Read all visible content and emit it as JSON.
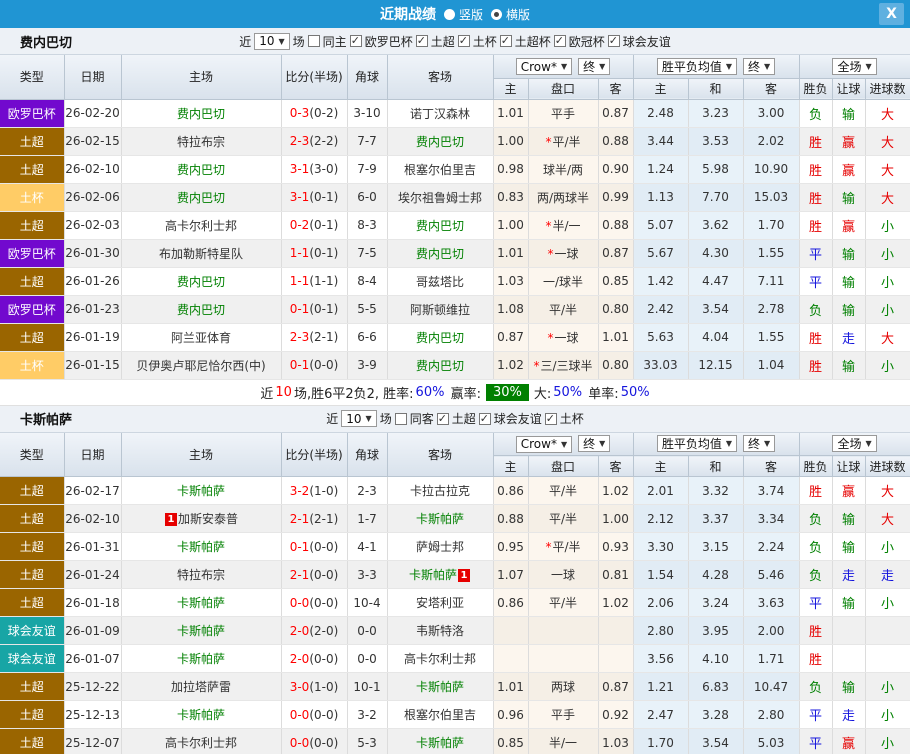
{
  "titlebar": {
    "title": "近期战绩",
    "radio_vertical": "竖版",
    "radio_horizontal": "横版",
    "selected_mode": "横版",
    "close_label": "X"
  },
  "colors": {
    "topbar": "#2095d3",
    "type_badges": {
      "欧罗巴杯": "#7209ce",
      "土超": "#9a6500",
      "土杯": "#ffcc66",
      "球会友谊": "#18a5a5",
      "欧冠杯": "#7209ce",
      "土超杯": "#9a6500"
    },
    "win_red": "#e60000",
    "lose_green": "#008000",
    "draw_blue": "#1414dd",
    "summary_badge_green": "#008000"
  },
  "table_header": {
    "type": "类型",
    "date": "日期",
    "home": "主场",
    "score": "比分(半场)",
    "corner": "角球",
    "away": "客场",
    "odds_group": "Crow*",
    "final1": "终",
    "mean_group": "胜平负均值",
    "final2": "终",
    "full_group": "全场",
    "sub": [
      "主",
      "盘口",
      "客",
      "主",
      "和",
      "客",
      "胜负",
      "让球",
      "进球数"
    ]
  },
  "sections": [
    {
      "team": "费内巴切",
      "filter": {
        "near": "近",
        "count": "10",
        "games": "场",
        "same": "同主",
        "same_checked": false,
        "leagues": [
          "欧罗巴杯",
          "土超",
          "土杯",
          "土超杯",
          "欧冠杯",
          "球会友谊"
        ]
      },
      "rows": [
        {
          "t": "欧罗巴杯",
          "d": "26-02-20",
          "h": "费内巴切",
          "hg": true,
          "hb": "",
          "s": "0-3",
          "hf": "(0-2)",
          "c": "3-10",
          "a": "诺丁汉森林",
          "ag": false,
          "ab": "",
          "o1": "1.01",
          "st": false,
          "hc": "平手",
          "o2": "0.87",
          "m1": "2.48",
          "m2": "3.23",
          "m3": "3.00",
          "r1": "负",
          "c1": "g",
          "r2": "输",
          "c2": "g",
          "r3": "大",
          "c3": "r"
        },
        {
          "t": "土超",
          "d": "26-02-15",
          "h": "特拉布宗",
          "hg": false,
          "hb": "",
          "s": "2-3",
          "hf": "(2-2)",
          "c": "7-7",
          "a": "费内巴切",
          "ag": true,
          "ab": "",
          "o1": "1.00",
          "st": true,
          "hc": "平/半",
          "o2": "0.88",
          "m1": "3.44",
          "m2": "3.53",
          "m3": "2.02",
          "r1": "胜",
          "c1": "r",
          "r2": "赢",
          "c2": "r",
          "r3": "大",
          "c3": "r"
        },
        {
          "t": "土超",
          "d": "26-02-10",
          "h": "费内巴切",
          "hg": true,
          "hb": "",
          "s": "3-1",
          "hf": "(3-0)",
          "c": "7-9",
          "a": "根塞尔伯里吉",
          "ag": false,
          "ab": "",
          "o1": "0.98",
          "st": false,
          "hc": "球半/两",
          "o2": "0.90",
          "m1": "1.24",
          "m2": "5.98",
          "m3": "10.90",
          "r1": "胜",
          "c1": "r",
          "r2": "赢",
          "c2": "r",
          "r3": "大",
          "c3": "r"
        },
        {
          "t": "土杯",
          "d": "26-02-06",
          "h": "费内巴切",
          "hg": true,
          "hb": "",
          "s": "3-1",
          "hf": "(0-1)",
          "c": "6-0",
          "a": "埃尔祖鲁姆士邦",
          "ag": false,
          "ab": "",
          "o1": "0.83",
          "st": false,
          "hc": "两/两球半",
          "o2": "0.99",
          "m1": "1.13",
          "m2": "7.70",
          "m3": "15.03",
          "r1": "胜",
          "c1": "r",
          "r2": "输",
          "c2": "g",
          "r3": "大",
          "c3": "r"
        },
        {
          "t": "土超",
          "d": "26-02-03",
          "h": "高卡尔利士邦",
          "hg": false,
          "hb": "",
          "s": "0-2",
          "hf": "(0-1)",
          "c": "8-3",
          "a": "费内巴切",
          "ag": true,
          "ab": "",
          "o1": "1.00",
          "st": true,
          "hc": "半/一",
          "o2": "0.88",
          "m1": "5.07",
          "m2": "3.62",
          "m3": "1.70",
          "r1": "胜",
          "c1": "r",
          "r2": "赢",
          "c2": "r",
          "r3": "小",
          "c3": "g"
        },
        {
          "t": "欧罗巴杯",
          "d": "26-01-30",
          "h": "布加勒斯特星队",
          "hg": false,
          "hb": "",
          "s": "1-1",
          "hf": "(0-1)",
          "c": "7-5",
          "a": "费内巴切",
          "ag": true,
          "ab": "",
          "o1": "1.01",
          "st": true,
          "hc": "一球",
          "o2": "0.87",
          "m1": "5.67",
          "m2": "4.30",
          "m3": "1.55",
          "r1": "平",
          "c1": "b",
          "r2": "输",
          "c2": "g",
          "r3": "小",
          "c3": "g"
        },
        {
          "t": "土超",
          "d": "26-01-26",
          "h": "费内巴切",
          "hg": true,
          "hb": "",
          "s": "1-1",
          "hf": "(1-1)",
          "c": "8-4",
          "a": "哥兹塔比",
          "ag": false,
          "ab": "",
          "o1": "1.03",
          "st": false,
          "hc": "一/球半",
          "o2": "0.85",
          "m1": "1.42",
          "m2": "4.47",
          "m3": "7.11",
          "r1": "平",
          "c1": "b",
          "r2": "输",
          "c2": "g",
          "r3": "小",
          "c3": "g"
        },
        {
          "t": "欧罗巴杯",
          "d": "26-01-23",
          "h": "费内巴切",
          "hg": true,
          "hb": "",
          "s": "0-1",
          "hf": "(0-1)",
          "c": "5-5",
          "a": "阿斯顿维拉",
          "ag": false,
          "ab": "",
          "o1": "1.08",
          "st": false,
          "hc": "平/半",
          "o2": "0.80",
          "m1": "2.42",
          "m2": "3.54",
          "m3": "2.78",
          "r1": "负",
          "c1": "g",
          "r2": "输",
          "c2": "g",
          "r3": "小",
          "c3": "g"
        },
        {
          "t": "土超",
          "d": "26-01-19",
          "h": "阿兰亚体育",
          "hg": false,
          "hb": "",
          "s": "2-3",
          "hf": "(2-1)",
          "c": "6-6",
          "a": "费内巴切",
          "ag": true,
          "ab": "",
          "o1": "0.87",
          "st": true,
          "hc": "一球",
          "o2": "1.01",
          "m1": "5.63",
          "m2": "4.04",
          "m3": "1.55",
          "r1": "胜",
          "c1": "r",
          "r2": "走",
          "c2": "b",
          "r3": "大",
          "c3": "r"
        },
        {
          "t": "土杯",
          "d": "26-01-15",
          "h": "贝伊奥卢耶尼恰尔西(中)",
          "hg": false,
          "hb": "",
          "s": "0-1",
          "hf": "(0-0)",
          "c": "3-9",
          "a": "费内巴切",
          "ag": true,
          "ab": "",
          "o1": "1.02",
          "st": true,
          "hc": "三/三球半",
          "o2": "0.80",
          "m1": "33.03",
          "m2": "12.15",
          "m3": "1.04",
          "r1": "胜",
          "c1": "r",
          "r2": "输",
          "c2": "g",
          "r3": "小",
          "c3": "g"
        }
      ],
      "summary": {
        "p1": "近",
        "n": "10",
        "p2": "场,胜6平2负2, 胜率:",
        "win_rate": "60%",
        "p3": "赢率:",
        "badge": "30%",
        "p4": "大:",
        "big_rate": "50%",
        "p5": "单率:",
        "single_rate": "50%"
      }
    },
    {
      "team": "卡斯帕萨",
      "filter": {
        "near": "近",
        "count": "10",
        "games": "场",
        "same": "同客",
        "same_checked": false,
        "leagues": [
          "土超",
          "球会友谊",
          "土杯"
        ]
      },
      "rows": [
        {
          "t": "土超",
          "d": "26-02-17",
          "h": "卡斯帕萨",
          "hg": true,
          "hb": "",
          "s": "3-2",
          "hf": "(1-0)",
          "c": "2-3",
          "a": "卡拉古拉克",
          "ag": false,
          "ab": "",
          "o1": "0.86",
          "st": false,
          "hc": "平/半",
          "o2": "1.02",
          "m1": "2.01",
          "m2": "3.32",
          "m3": "3.74",
          "r1": "胜",
          "c1": "r",
          "r2": "赢",
          "c2": "r",
          "r3": "大",
          "c3": "r"
        },
        {
          "t": "土超",
          "d": "26-02-10",
          "h": "加斯安泰普",
          "hg": false,
          "hb": "1",
          "s": "2-1",
          "hf": "(2-1)",
          "c": "1-7",
          "a": "卡斯帕萨",
          "ag": true,
          "ab": "",
          "o1": "0.88",
          "st": false,
          "hc": "平/半",
          "o2": "1.00",
          "m1": "2.12",
          "m2": "3.37",
          "m3": "3.34",
          "r1": "负",
          "c1": "g",
          "r2": "输",
          "c2": "g",
          "r3": "大",
          "c3": "r"
        },
        {
          "t": "土超",
          "d": "26-01-31",
          "h": "卡斯帕萨",
          "hg": true,
          "hb": "",
          "s": "0-1",
          "hf": "(0-0)",
          "c": "4-1",
          "a": "萨姆士邦",
          "ag": false,
          "ab": "",
          "o1": "0.95",
          "st": true,
          "hc": "平/半",
          "o2": "0.93",
          "m1": "3.30",
          "m2": "3.15",
          "m3": "2.24",
          "r1": "负",
          "c1": "g",
          "r2": "输",
          "c2": "g",
          "r3": "小",
          "c3": "g"
        },
        {
          "t": "土超",
          "d": "26-01-24",
          "h": "特拉布宗",
          "hg": false,
          "hb": "",
          "s": "2-1",
          "hf": "(0-0)",
          "c": "3-3",
          "a": "卡斯帕萨",
          "ag": true,
          "ab": "1",
          "o1": "1.07",
          "st": false,
          "hc": "一球",
          "o2": "0.81",
          "m1": "1.54",
          "m2": "4.28",
          "m3": "5.46",
          "r1": "负",
          "c1": "g",
          "r2": "走",
          "c2": "b",
          "r3": "走",
          "c3": "b"
        },
        {
          "t": "土超",
          "d": "26-01-18",
          "h": "卡斯帕萨",
          "hg": true,
          "hb": "",
          "s": "0-0",
          "hf": "(0-0)",
          "c": "10-4",
          "a": "安塔利亚",
          "ag": false,
          "ab": "",
          "o1": "0.86",
          "st": false,
          "hc": "平/半",
          "o2": "1.02",
          "m1": "2.06",
          "m2": "3.24",
          "m3": "3.63",
          "r1": "平",
          "c1": "b",
          "r2": "输",
          "c2": "g",
          "r3": "小",
          "c3": "g"
        },
        {
          "t": "球会友谊",
          "d": "26-01-09",
          "h": "卡斯帕萨",
          "hg": true,
          "hb": "",
          "s": "2-0",
          "hf": "(2-0)",
          "c": "0-0",
          "a": "韦斯特洛",
          "ag": false,
          "ab": "",
          "o1": "",
          "st": false,
          "hc": "",
          "o2": "",
          "m1": "2.80",
          "m2": "3.95",
          "m3": "2.00",
          "r1": "胜",
          "c1": "r",
          "r2": "",
          "c2": "g",
          "r3": "",
          "c3": "g"
        },
        {
          "t": "球会友谊",
          "d": "26-01-07",
          "h": "卡斯帕萨",
          "hg": true,
          "hb": "",
          "s": "2-0",
          "hf": "(0-0)",
          "c": "0-0",
          "a": "高卡尔利士邦",
          "ag": false,
          "ab": "",
          "o1": "",
          "st": false,
          "hc": "",
          "o2": "",
          "m1": "3.56",
          "m2": "4.10",
          "m3": "1.71",
          "r1": "胜",
          "c1": "r",
          "r2": "",
          "c2": "g",
          "r3": "",
          "c3": "g"
        },
        {
          "t": "土超",
          "d": "25-12-22",
          "h": "加拉塔萨雷",
          "hg": false,
          "hb": "",
          "s": "3-0",
          "hf": "(1-0)",
          "c": "10-1",
          "a": "卡斯帕萨",
          "ag": true,
          "ab": "",
          "o1": "1.01",
          "st": false,
          "hc": "两球",
          "o2": "0.87",
          "m1": "1.21",
          "m2": "6.83",
          "m3": "10.47",
          "r1": "负",
          "c1": "g",
          "r2": "输",
          "c2": "g",
          "r3": "小",
          "c3": "g"
        },
        {
          "t": "土超",
          "d": "25-12-13",
          "h": "卡斯帕萨",
          "hg": true,
          "hb": "",
          "s": "0-0",
          "hf": "(0-0)",
          "c": "3-2",
          "a": "根塞尔伯里吉",
          "ag": false,
          "ab": "",
          "o1": "0.96",
          "st": false,
          "hc": "平手",
          "o2": "0.92",
          "m1": "2.47",
          "m2": "3.28",
          "m3": "2.80",
          "r1": "平",
          "c1": "b",
          "r2": "走",
          "c2": "b",
          "r3": "小",
          "c3": "g"
        },
        {
          "t": "土超",
          "d": "25-12-07",
          "h": "高卡尔利士邦",
          "hg": false,
          "hb": "",
          "s": "0-0",
          "hf": "(0-0)",
          "c": "5-3",
          "a": "卡斯帕萨",
          "ag": true,
          "ab": "",
          "o1": "0.85",
          "st": false,
          "hc": "半/一",
          "o2": "1.03",
          "m1": "1.70",
          "m2": "3.54",
          "m3": "5.03",
          "r1": "平",
          "c1": "b",
          "r2": "赢",
          "c2": "r",
          "r3": "小",
          "c3": "g"
        }
      ],
      "summary": null
    }
  ]
}
